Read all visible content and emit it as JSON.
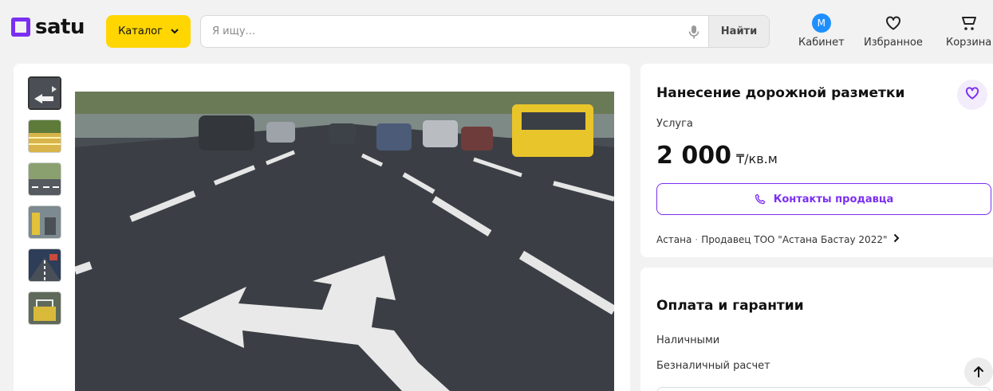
{
  "header": {
    "logo_text": "satu",
    "catalog_label": "Каталог",
    "search_placeholder": "Я ищу...",
    "search_value": "",
    "find_label": "Найти",
    "cabinet": {
      "avatar_letter": "M",
      "label": "Кабинет"
    },
    "favorites_label": "Избранное",
    "cart_label": "Корзина"
  },
  "gallery": {
    "thumbnail_count": 6,
    "active_index": 0
  },
  "product": {
    "title": "Нанесение дорожной разметки",
    "type": "Услуга",
    "price": "2 000",
    "price_unit": "₸/кв.м",
    "contact_label": "Контакты продавца",
    "city": "Астана",
    "separator": "·",
    "seller": "Продавец ТОО \"Астана Бастау 2022\""
  },
  "payment": {
    "title": "Оплата и гарантии",
    "items": [
      "Наличными",
      "Безналичный расчет"
    ]
  },
  "colors": {
    "accent": "#7b2ff2",
    "catalog_yellow": "#ffd600",
    "avatar_blue": "#1f8fff",
    "background": "#f2f2f2"
  }
}
